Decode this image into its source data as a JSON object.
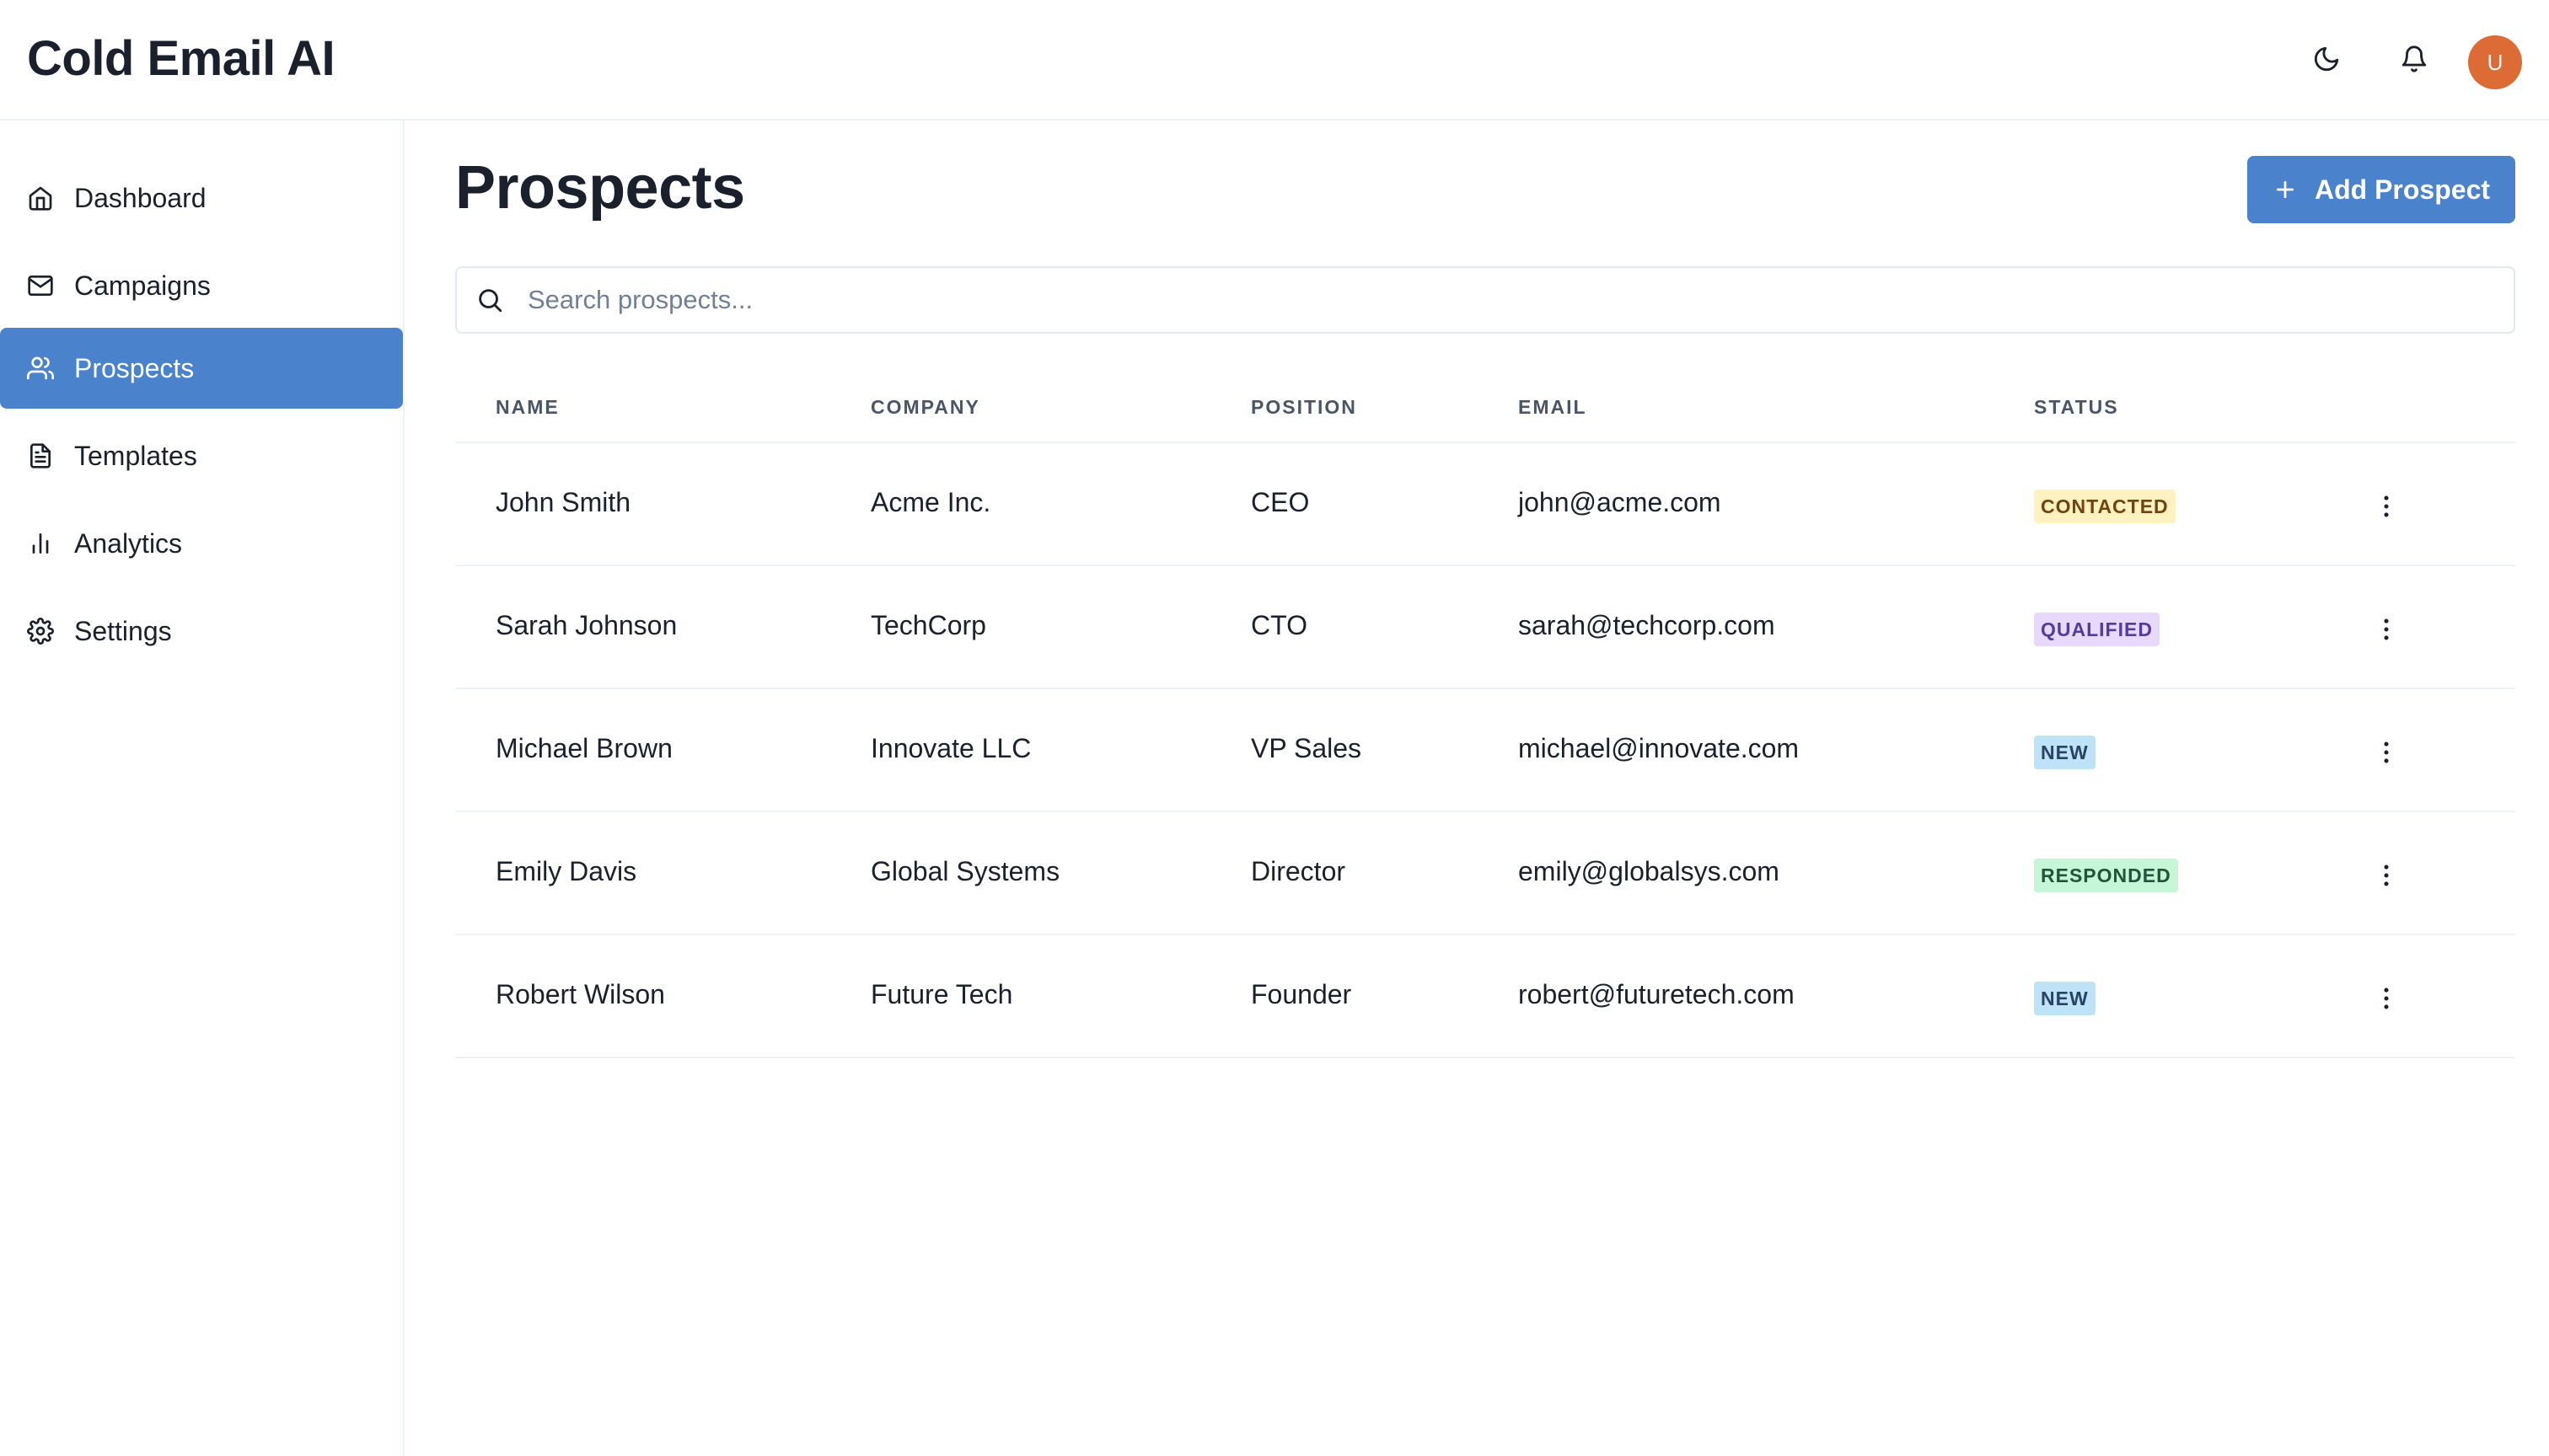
{
  "header": {
    "app_title": "Cold Email AI",
    "avatar_initial": "U"
  },
  "sidebar": {
    "items": [
      {
        "label": "Dashboard",
        "icon": "home-icon"
      },
      {
        "label": "Campaigns",
        "icon": "mail-icon"
      },
      {
        "label": "Prospects",
        "icon": "users-icon",
        "active": true
      },
      {
        "label": "Templates",
        "icon": "file-text-icon"
      },
      {
        "label": "Analytics",
        "icon": "bar-chart-icon"
      },
      {
        "label": "Settings",
        "icon": "gear-icon"
      }
    ]
  },
  "main": {
    "title": "Prospects",
    "add_button_label": "Add Prospect",
    "search_placeholder": "Search prospects...",
    "columns": [
      "NAME",
      "COMPANY",
      "POSITION",
      "EMAIL",
      "STATUS"
    ],
    "rows": [
      {
        "name": "John Smith",
        "company": "Acme Inc.",
        "position": "CEO",
        "email": "john@acme.com",
        "status": "CONTACTED"
      },
      {
        "name": "Sarah Johnson",
        "company": "TechCorp",
        "position": "CTO",
        "email": "sarah@techcorp.com",
        "status": "QUALIFIED"
      },
      {
        "name": "Michael Brown",
        "company": "Innovate LLC",
        "position": "VP Sales",
        "email": "michael@innovate.com",
        "status": "NEW"
      },
      {
        "name": "Emily Davis",
        "company": "Global Systems",
        "position": "Director",
        "email": "emily@globalsys.com",
        "status": "RESPONDED"
      },
      {
        "name": "Robert Wilson",
        "company": "Future Tech",
        "position": "Founder",
        "email": "robert@futuretech.com",
        "status": "NEW"
      }
    ]
  },
  "colors": {
    "accent": "#4a82cc",
    "avatar": "#dd6b35",
    "status": {
      "CONTACTED": {
        "bg": "#fef3c0",
        "fg": "#744210"
      },
      "QUALIFIED": {
        "bg": "#e9d8fd",
        "fg": "#553c9a"
      },
      "NEW": {
        "bg": "#bee3f8",
        "fg": "#2a4365"
      },
      "RESPONDED": {
        "bg": "#c6f6d5",
        "fg": "#22543d"
      }
    }
  }
}
